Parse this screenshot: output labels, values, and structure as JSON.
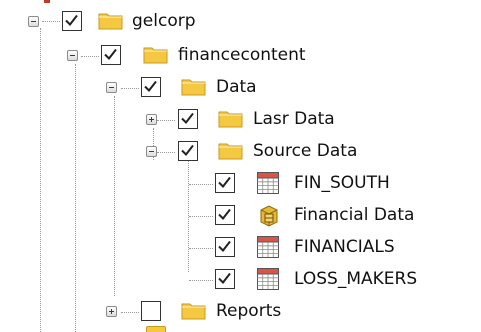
{
  "tree": {
    "nodes": [
      {
        "id": "gelcorp",
        "label": "gelcorp",
        "icon": "folder-icon",
        "checked": true,
        "expander": "minus"
      },
      {
        "id": "financecontent",
        "label": "financecontent",
        "icon": "folder-icon",
        "checked": true,
        "expander": "minus"
      },
      {
        "id": "data",
        "label": "Data",
        "icon": "folder-icon",
        "checked": true,
        "expander": "minus"
      },
      {
        "id": "lasr-data",
        "label": "Lasr Data",
        "icon": "folder-icon",
        "checked": true,
        "expander": "plus"
      },
      {
        "id": "source-data",
        "label": "Source Data",
        "icon": "folder-icon",
        "checked": true,
        "expander": "minus"
      },
      {
        "id": "fin-south",
        "label": "FIN_SOUTH",
        "icon": "table-icon",
        "checked": true,
        "expander": "none"
      },
      {
        "id": "financial-data",
        "label": "Financial Data",
        "icon": "cube-icon",
        "checked": true,
        "expander": "none"
      },
      {
        "id": "financials",
        "label": "FINANCIALS",
        "icon": "table-icon",
        "checked": true,
        "expander": "none"
      },
      {
        "id": "loss-makers",
        "label": "LOSS_MAKERS",
        "icon": "table-icon",
        "checked": true,
        "expander": "none"
      },
      {
        "id": "reports",
        "label": "Reports",
        "icon": "folder-icon",
        "checked": false,
        "expander": "plus"
      }
    ]
  },
  "colors": {
    "folder": "#f5c842",
    "folder_dark": "#c99a1a",
    "table_header": "#d9534f",
    "grid": "#8a8a8a",
    "check": "#222222"
  }
}
